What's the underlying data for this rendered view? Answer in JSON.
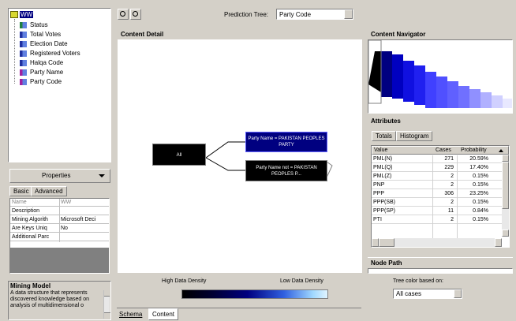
{
  "tree": {
    "root": "WW",
    "items": [
      {
        "label": "Status",
        "icon": "key-column-icon"
      },
      {
        "label": "Total Votes",
        "icon": "column-icon"
      },
      {
        "label": "Election Date",
        "icon": "column-icon"
      },
      {
        "label": "Registered Voters",
        "icon": "column-icon"
      },
      {
        "label": "Halqa Code",
        "icon": "column-icon"
      },
      {
        "label": "Party Name",
        "icon": "predict-column-icon"
      },
      {
        "label": "Party Code",
        "icon": "predict-column-icon"
      }
    ]
  },
  "properties": {
    "title": "Properties",
    "tabs": [
      "Basic",
      "Advanced"
    ],
    "rows": [
      {
        "name": "Name",
        "value": "WW"
      },
      {
        "name": "Description",
        "value": ""
      },
      {
        "name": "Mining Algorith",
        "value": "Microsoft Deci"
      },
      {
        "name": "Are Keys Uniq",
        "value": "No"
      },
      {
        "name": "Additional Parc",
        "value": ""
      }
    ]
  },
  "description": {
    "title": "Mining Model",
    "text": "A data structure that represents discovered knowledge based on analysis of multidimensional o"
  },
  "toolbar": {
    "prediction_tree_label": "Prediction Tree:",
    "prediction_tree_value": "Party Code"
  },
  "content_detail": {
    "title": "Content Detail",
    "root_node": "All",
    "node_1": "Party Name = PAKISTAN PEOPLES PARTY",
    "node_2": "Party Name not = PAKISTAN PEOPLES P..."
  },
  "content_navigator": {
    "title": "Content Navigator"
  },
  "attributes": {
    "title": "Attributes",
    "tabs": [
      "Totals",
      "Histogram"
    ],
    "columns": [
      "Value",
      "Cases",
      "Probability"
    ],
    "rows": [
      {
        "value": "PML(N)",
        "cases": "271",
        "prob": "20.59%"
      },
      {
        "value": "PML(Q)",
        "cases": "229",
        "prob": "17.40%"
      },
      {
        "value": "PML(Z)",
        "cases": "2",
        "prob": "0.15%"
      },
      {
        "value": "PNP",
        "cases": "2",
        "prob": "0.15%"
      },
      {
        "value": "PPP",
        "cases": "306",
        "prob": "23.25%"
      },
      {
        "value": "PPP(SB)",
        "cases": "2",
        "prob": "0.15%"
      },
      {
        "value": "PPP(SP)",
        "cases": "11",
        "prob": "0.84%"
      },
      {
        "value": "PTI",
        "cases": "2",
        "prob": "0.15%"
      }
    ]
  },
  "node_path": {
    "title": "Node Path"
  },
  "legend": {
    "high": "High Data Density",
    "low": "Low Data Density",
    "tree_color_label": "Tree color based on:",
    "tree_color_value": "All cases"
  },
  "bottom_tabs": [
    "Schema",
    "Content"
  ],
  "colors": {
    "node_bg": "#000000",
    "node_selected": "#000080",
    "accent": "#1a1a9e"
  }
}
